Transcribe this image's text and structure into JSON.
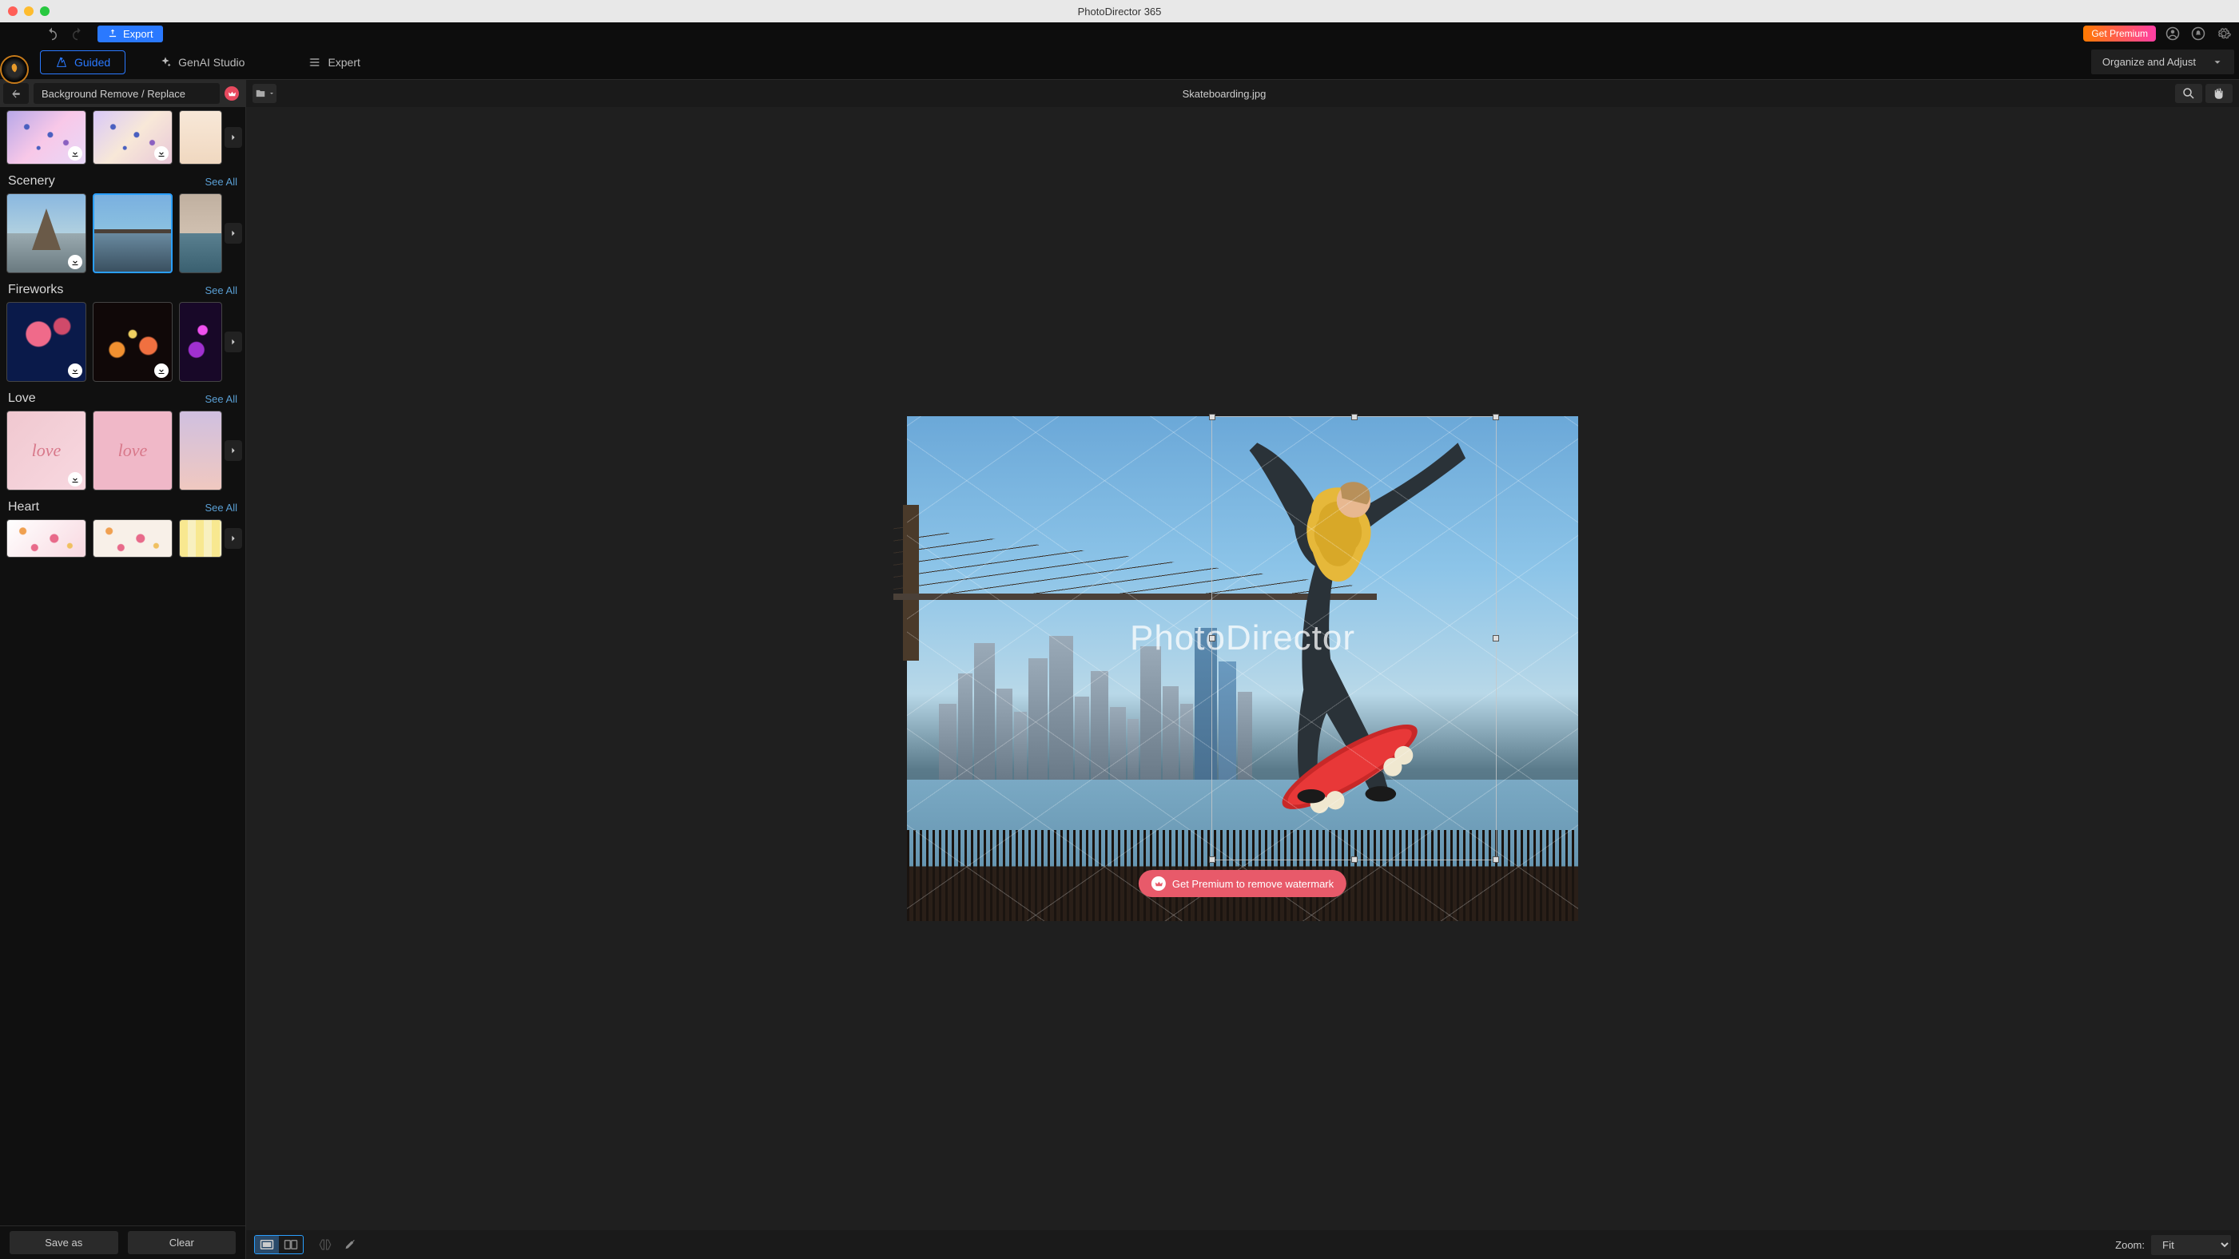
{
  "window": {
    "title": "PhotoDirector 365"
  },
  "toolbar": {
    "export_label": "Export",
    "get_premium_label": "Get Premium"
  },
  "tabs": {
    "guided": "Guided",
    "genai": "GenAI Studio",
    "expert": "Expert",
    "active": "guided"
  },
  "organize_button": "Organize and Adjust",
  "sidebar": {
    "title": "Background Remove / Replace",
    "see_all_label": "See All",
    "categories": [
      {
        "name": "",
        "first_row": true,
        "thumbs": [
          {
            "id": "butterfly-sky-1",
            "cls": "grad-butterfly",
            "download": true,
            "deco": "butterfly"
          },
          {
            "id": "butterfly-sky-2",
            "cls": "grad-butterfly2",
            "download": true,
            "deco": "butterfly"
          },
          {
            "id": "butterfly-warm",
            "cls": "grad-butterfly3",
            "download": false,
            "partial": true
          }
        ]
      },
      {
        "name": "Scenery",
        "thumbs": [
          {
            "id": "eiffel-tower",
            "cls": "grad-eiffel",
            "download": true,
            "deco": "eiffel"
          },
          {
            "id": "city-bridge",
            "cls": "grad-bridge",
            "download": false,
            "selected": true
          },
          {
            "id": "venice-canal",
            "cls": "grad-venice",
            "download": false,
            "partial": true
          }
        ]
      },
      {
        "name": "Fireworks",
        "thumbs": [
          {
            "id": "fireworks-hearts",
            "cls": "grad-fw1",
            "download": true
          },
          {
            "id": "fireworks-gold",
            "cls": "grad-fw2",
            "download": true
          },
          {
            "id": "fireworks-purple",
            "cls": "grad-fw3",
            "download": false,
            "partial": true
          }
        ]
      },
      {
        "name": "Love",
        "thumbs": [
          {
            "id": "love-script-1",
            "cls": "grad-love1",
            "download": true,
            "deco": "love"
          },
          {
            "id": "love-script-2",
            "cls": "grad-love2",
            "download": false,
            "deco": "love"
          },
          {
            "id": "love-pastel",
            "cls": "grad-love3",
            "download": false,
            "partial": true
          }
        ]
      },
      {
        "name": "Heart",
        "thumbs": [
          {
            "id": "hearts-pink",
            "cls": "grad-heart1",
            "download": false,
            "deco": "hearts",
            "small": true
          },
          {
            "id": "hearts-cream",
            "cls": "grad-heart2",
            "download": false,
            "deco": "hearts",
            "small": true
          },
          {
            "id": "hearts-stripe",
            "cls": "grad-heart3",
            "download": false,
            "small": true,
            "partial": true
          }
        ]
      }
    ],
    "footer": {
      "save_as": "Save as",
      "clear": "Clear"
    }
  },
  "canvas": {
    "filename": "Skateboarding.jpg",
    "watermark_text": "PhotoDirector",
    "premium_nag": "Get Premium to remove watermark",
    "zoom_label": "Zoom:",
    "zoom_value": "Fit"
  }
}
